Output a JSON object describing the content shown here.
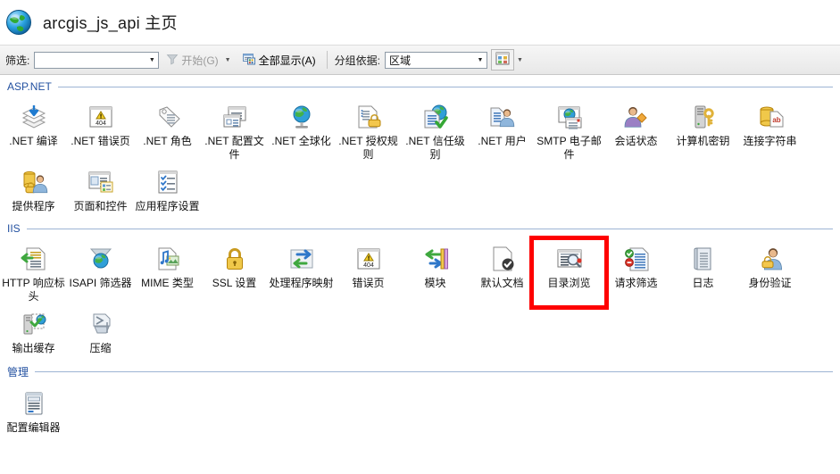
{
  "window": {
    "icon": "globe-icon",
    "title": "arcgis_js_api 主页"
  },
  "toolbar": {
    "filter_label": "筛选:",
    "filter_value": "",
    "filter_placeholder": "",
    "go_button": "开始(G)",
    "go_icon": "funnel-icon",
    "show_all_button": "全部显示(A)",
    "show_all_icon": "show-all-icon",
    "groupby_label": "分组依据:",
    "groupby_value": "区域",
    "view_icon": "view-mode-icon"
  },
  "groups": [
    {
      "title": "ASP.NET",
      "items": [
        {
          "label": ".NET 编译",
          "icon": "compilation-icon"
        },
        {
          "label": ".NET 错误页",
          "icon": "error-pages-404-icon"
        },
        {
          "label": ".NET 角色",
          "icon": "roles-tag-icon"
        },
        {
          "label": ".NET 配置文件",
          "icon": "profile-icon"
        },
        {
          "label": ".NET 全球化",
          "icon": "globalization-globe-icon"
        },
        {
          "label": ".NET 授权规则",
          "icon": "authorization-lock-icon"
        },
        {
          "label": ".NET 信任级别",
          "icon": "trust-levels-check-icon"
        },
        {
          "label": ".NET 用户",
          "icon": "users-icon"
        },
        {
          "label": "SMTP 电子邮件",
          "icon": "smtp-email-icon"
        },
        {
          "label": "会话状态",
          "icon": "session-state-icon"
        },
        {
          "label": "计算机密钥",
          "icon": "machine-key-icon"
        },
        {
          "label": "连接字符串",
          "icon": "connection-strings-icon"
        },
        {
          "label": "提供程序",
          "icon": "providers-icon"
        },
        {
          "label": "页面和控件",
          "icon": "pages-controls-icon"
        },
        {
          "label": "应用程序设置",
          "icon": "app-settings-icon"
        }
      ]
    },
    {
      "title": "IIS",
      "items": [
        {
          "label": "HTTP 响应标头",
          "icon": "http-response-headers-icon"
        },
        {
          "label": "ISAPI 筛选器",
          "icon": "isapi-filters-icon"
        },
        {
          "label": "MIME 类型",
          "icon": "mime-types-icon"
        },
        {
          "label": "SSL 设置",
          "icon": "ssl-settings-lock-icon"
        },
        {
          "label": "处理程序映射",
          "icon": "handler-mappings-icon"
        },
        {
          "label": "错误页",
          "icon": "error-pages-404-icon"
        },
        {
          "label": "模块",
          "icon": "modules-icon"
        },
        {
          "label": "默认文档",
          "icon": "default-document-icon"
        },
        {
          "label": "目录浏览",
          "icon": "directory-browsing-icon",
          "highlighted": true
        },
        {
          "label": "请求筛选",
          "icon": "request-filtering-icon"
        },
        {
          "label": "日志",
          "icon": "logging-book-icon"
        },
        {
          "label": "身份验证",
          "icon": "authentication-icon"
        },
        {
          "label": "输出缓存",
          "icon": "output-caching-icon"
        },
        {
          "label": "压缩",
          "icon": "compression-icon"
        }
      ]
    },
    {
      "title": "管理",
      "items": [
        {
          "label": "配置编辑器",
          "icon": "configuration-editor-icon"
        }
      ]
    }
  ],
  "highlight": {
    "color": "#fe0000",
    "target": "目录浏览"
  }
}
